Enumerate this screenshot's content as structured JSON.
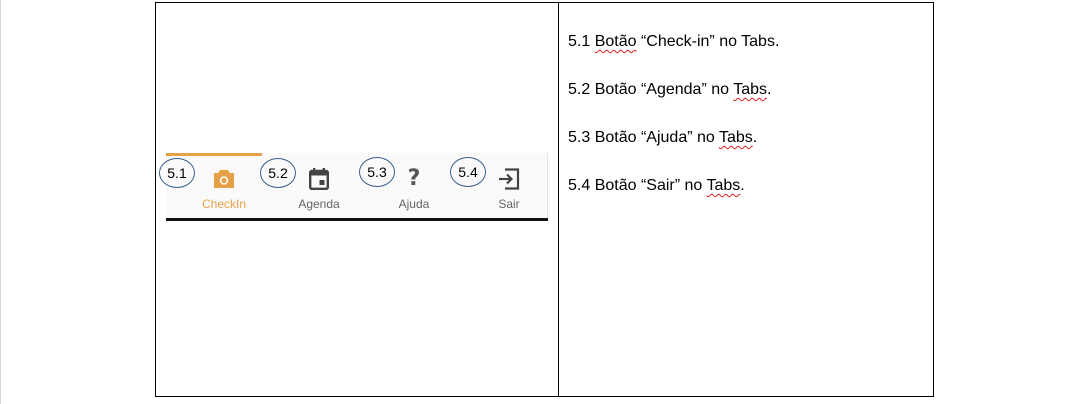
{
  "tabs": [
    {
      "id": "checkin",
      "label": "CheckIn",
      "callout": "5.1",
      "icon": "camera-icon",
      "active": true
    },
    {
      "id": "agenda",
      "label": "Agenda",
      "callout": "5.2",
      "icon": "calendar-icon",
      "active": false
    },
    {
      "id": "ajuda",
      "label": "Ajuda",
      "callout": "5.3",
      "icon": "help-icon",
      "active": false
    },
    {
      "id": "sair",
      "label": "Sair",
      "callout": "5.4",
      "icon": "exit-icon",
      "active": false
    }
  ],
  "colors": {
    "active": "#e8a048",
    "inactive": "#666666",
    "callout_border": "#3a5f8a"
  },
  "descriptions": [
    {
      "num": "5.1",
      "word1": "Botão",
      "rest1": " “Check-in” no Tabs.",
      "word2": ""
    },
    {
      "num": "5.2",
      "word1": "Botão",
      "rest1": " “Agenda” no ",
      "word2": "Tabs",
      "rest2": "."
    },
    {
      "num": "5.3",
      "word1": "Botão",
      "rest1": " “Ajuda” no ",
      "word2": "Tabs",
      "rest2": "."
    },
    {
      "num": "5.4",
      "word1": "Botão",
      "rest1": " “Sair” no ",
      "word2": "Tabs",
      "rest2": "."
    }
  ]
}
